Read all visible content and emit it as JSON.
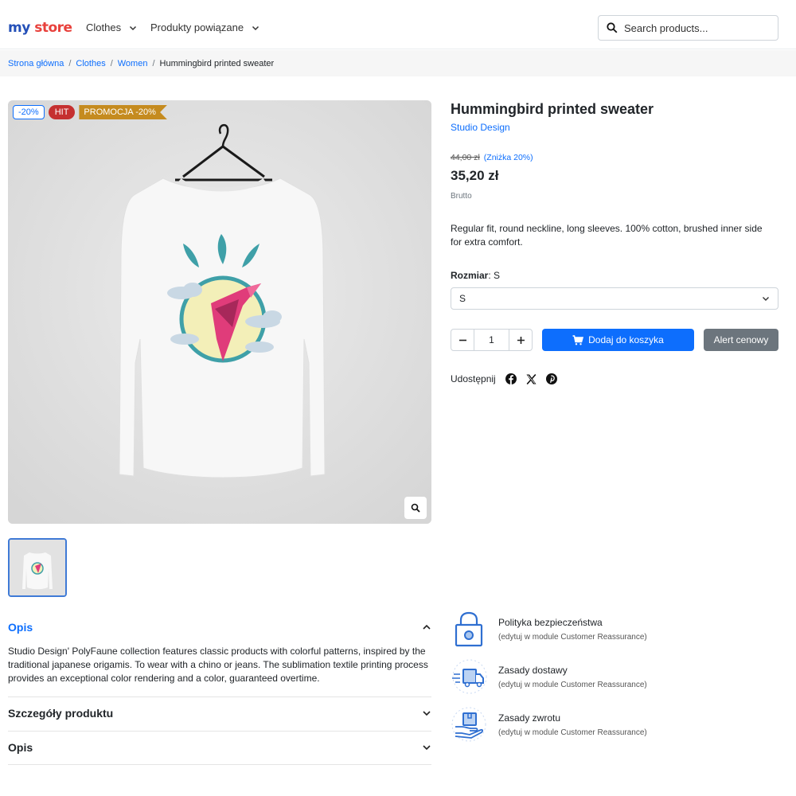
{
  "header": {
    "logo_my": "my",
    "logo_store": "store",
    "nav": [
      {
        "label": "Clothes"
      },
      {
        "label": "Produkty powiązane"
      }
    ],
    "search_placeholder": "Search products..."
  },
  "breadcrumb": {
    "items": [
      "Strona główna",
      "Clothes",
      "Women"
    ],
    "current": "Hummingbird printed sweater"
  },
  "product": {
    "badges": {
      "discount": "-20%",
      "hit": "HIT",
      "promo": "PROMOCJA -20%"
    },
    "title": "Hummingbird printed sweater",
    "brand": "Studio Design",
    "old_price": "44,00 zł",
    "discount_label": "(Zniżka 20%)",
    "price": "35,20 zł",
    "tax_label": "Brutto",
    "short_description": "Regular fit, round neckline, long sleeves. 100% cotton, brushed inner side for extra comfort.",
    "size_label": "Rozmiar",
    "size_value": "S",
    "size_select_value": "S",
    "quantity": "1",
    "add_to_cart": "Dodaj do koszyka",
    "price_alert": "Alert cenowy",
    "share_label": "Udostępnij"
  },
  "accordion": [
    {
      "title": "Opis",
      "expanded": true,
      "body": "Studio Design' PolyFaune collection features classic products with colorful patterns, inspired by the traditional japanese origamis. To wear with a chino or jeans. The sublimation textile printing process provides an exceptional color rendering and a color, guaranteed overtime."
    },
    {
      "title": "Szczegóły produktu",
      "expanded": false
    },
    {
      "title": "Opis",
      "expanded": false
    }
  ],
  "reassurance": [
    {
      "title": "Polityka bezpieczeństwa",
      "subtitle": "(edytuj w module Customer Reassurance)",
      "icon": "padlock-icon"
    },
    {
      "title": "Zasady dostawy",
      "subtitle": "(edytuj w module Customer Reassurance)",
      "icon": "delivery-truck-icon"
    },
    {
      "title": "Zasady zwrotu",
      "subtitle": "(edytuj w module Customer Reassurance)",
      "icon": "return-package-icon"
    }
  ],
  "colors": {
    "primary": "#0d6efd",
    "secondary": "#6c757d",
    "hit": "#c53030",
    "promo": "#c58b1f"
  }
}
